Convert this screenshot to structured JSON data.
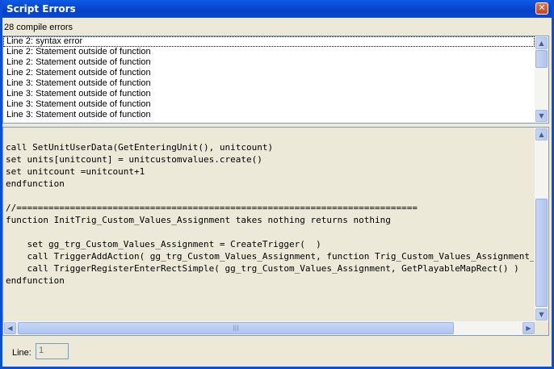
{
  "window": {
    "title": "Script Errors",
    "close_label": "✕"
  },
  "summary": "28 compile errors",
  "errors": [
    "Line 2: syntax error",
    "Line 2: Statement outside of function",
    "Line 2: Statement outside of function",
    "Line 2: Statement outside of function",
    "Line 3: Statement outside of function",
    "Line 3: Statement outside of function",
    "Line 3: Statement outside of function",
    "Line 3: Statement outside of function"
  ],
  "code_lines": [
    "call SetUnitUserData(GetEnteringUnit(), unitcount)",
    "set units[unitcount] = unitcustomvalues.create()",
    "set unitcount =unitcount+1",
    "endfunction",
    "",
    "//===========================================================================",
    "function InitTrig_Custom_Values_Assignment takes nothing returns nothing",
    "",
    "    set gg_trg_Custom_Values_Assignment = CreateTrigger(  )",
    "    call TriggerAddAction( gg_trg_Custom_Values_Assignment, function Trig_Custom_Values_Assignment_Actions )",
    "    call TriggerRegisterEnterRectSimple( gg_trg_Custom_Values_Assignment, GetPlayableMapRect() )",
    "endfunction"
  ],
  "footer": {
    "line_label": "Line:",
    "line_value": "1"
  },
  "icons": {
    "scroll_up": "▲",
    "scroll_down": "▼",
    "scroll_left": "◀",
    "scroll_right": "▶",
    "grip": "|||"
  }
}
